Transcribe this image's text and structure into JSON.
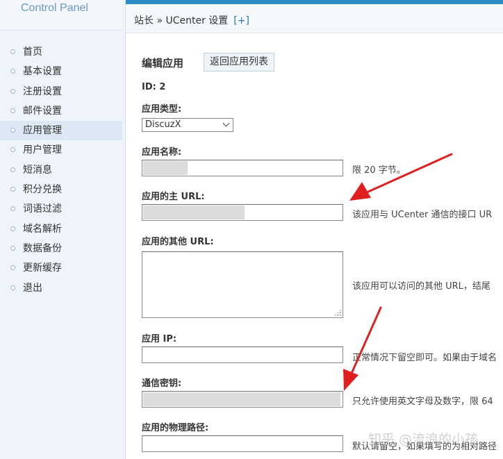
{
  "sidebar": {
    "brand": "Control Panel",
    "items": [
      {
        "label": "首页"
      },
      {
        "label": "基本设置"
      },
      {
        "label": "注册设置"
      },
      {
        "label": "邮件设置"
      },
      {
        "label": "应用管理"
      },
      {
        "label": "用户管理"
      },
      {
        "label": "短消息"
      },
      {
        "label": "积分兑换"
      },
      {
        "label": "词语过滤"
      },
      {
        "label": "域名解析"
      },
      {
        "label": "数据备份"
      },
      {
        "label": "更新缓存"
      },
      {
        "label": "退出"
      }
    ],
    "active_index": 4
  },
  "topbar": {
    "breadcrumb": "站长 » UCenter 设置",
    "plus": "[+]"
  },
  "form": {
    "title": "编辑应用",
    "back_button": "返回应用列表",
    "id_text": "ID: 2",
    "type_label": "应用类型:",
    "type_value": "DiscuzX",
    "name_label": "应用名称:",
    "name_hint": "限 20 字节。",
    "url_label": "应用的主 URL:",
    "url_hint": "该应用与 UCenter 通信的接口 UR",
    "other_url_label": "应用的其他 URL:",
    "other_url_hint": "该应用可以访问的其他 URL，结尾",
    "ip_label": "应用 IP:",
    "ip_hint": "正常情况下留空即可。如果由于域名",
    "key_label": "通信密钥:",
    "key_hint": "只允许使用英文字母及数字，限 64",
    "path_label": "应用的物理路径:",
    "path_hint": "默认请留空，如果填写的为相对路径"
  },
  "watermark": "知乎 @流浪的小孩",
  "colors": {
    "accent": "#2b8bc6",
    "annotation_arrow": "#e02020"
  }
}
